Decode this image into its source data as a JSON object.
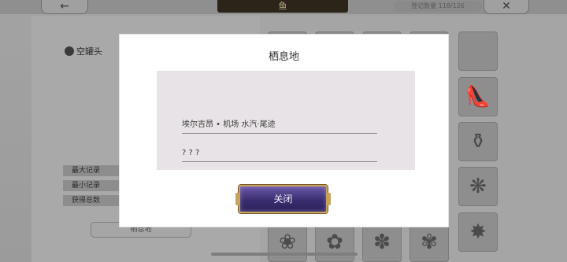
{
  "header": {
    "back_icon": "arrow-left-icon",
    "title": "鱼",
    "record_count": "登记数量 118/126",
    "close_icon": "close-x-icon"
  },
  "left_panel": {
    "bait_label": "空罐头",
    "stats": [
      "最大记录",
      "最小记录",
      "获得总数"
    ],
    "habitat_button": "栖息地"
  },
  "modal": {
    "title": "栖息地",
    "locations": [
      "埃尔吉昂 • 机场 水汽·尾迹",
      "? ? ?"
    ],
    "close_button": "关闭",
    "accent_color": "#c6a25a",
    "button_color": "#3a2d6f"
  },
  "grid_items": [
    {
      "icon": "shoe-icon"
    },
    {
      "icon": "jar-icon"
    },
    {
      "icon": "fish-icon"
    },
    {
      "icon": "fish-icon"
    },
    {
      "icon": "fish-icon"
    },
    {
      "icon": "fish-icon"
    },
    {
      "icon": "fish-icon"
    },
    {
      "icon": "fish-icon"
    }
  ]
}
